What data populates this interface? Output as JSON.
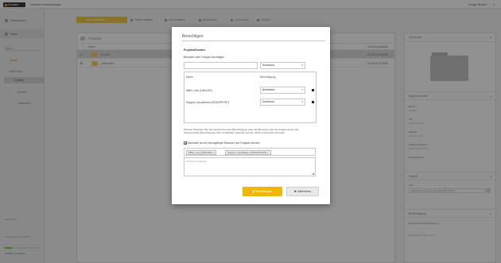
{
  "app": {
    "brand": "Goodset",
    "subtitle": "Document Dateimanager",
    "user": "Doogie Beaver"
  },
  "sidebar": {
    "items": [
      {
        "label": "Dashboard",
        "icon": "dashboard-icon"
      },
      {
        "label": "Drive",
        "icon": "drive-icon"
      }
    ],
    "search_placeholder": "Suche",
    "highlight_label": "Ablage",
    "tree_root": "Mein Drive",
    "tree_active": "Projekte",
    "tree_children": [
      "Kunden",
      "Lieferanten"
    ],
    "footer_label": "Papierkorb",
    "quota_text": "Freigegebener Speicher",
    "quota_fraction": 0.2,
    "footer_link": "Speicher verwalten"
  },
  "toolbar": {
    "upload_label": "Datei hochladen",
    "buttons": [
      "Ordner anlegen",
      "Herunterladen",
      "Berechtigen",
      "Link senden",
      "Löschen"
    ]
  },
  "files_panel": {
    "title": "Projekte",
    "columns": {
      "name": "Name",
      "modified": "Änderungsdatum"
    },
    "rows": [
      {
        "name": "Kunden",
        "date": "04.06.2015 09:08"
      },
      {
        "name": "Lieferanten",
        "date": "04.06.2015 09:08"
      }
    ]
  },
  "details_panel": {
    "title": "Vorschau",
    "section_title": "Eigenschaften",
    "props": [
      {
        "label": "Name",
        "value": "Kunden"
      },
      {
        "label": "Typ",
        "value": "Projektordner"
      },
      {
        "label": "Erstellt",
        "value": "Mueller, Lars"
      },
      {
        "label": "Änderungsdatum",
        "value": "04.06.2015 09:08"
      },
      {
        "label": "Beschreibung",
        "value": ""
      }
    ],
    "link_section": "Zugriff",
    "link_label": "Link",
    "link_value": "https://demo.docbox.de/index.php?id=5f3",
    "sharing_section": "Berechtigung",
    "sharing_text": "Gemeinsame Berechtigung",
    "sharing_sub": "Berechtigt: Mueller, Lars"
  },
  "dialog": {
    "title": "Berechtigen",
    "section": "Projekte/Kunden",
    "add_label": "Benutzer oder Gruppe hinzufügen",
    "add_input_value": "",
    "add_select": "Download",
    "col_name": "Name",
    "col_permission": "Berechtigung",
    "entries": [
      {
        "name": "Miller, Lars (LMILLER)",
        "permission": "Bearbeiten"
      },
      {
        "name": "Support, docu4beam (DSSUPPORT)",
        "permission": "Download"
      }
    ],
    "hint": "Hinweis: Beachten Sie beim Entfernen einer Berechtigung, dass der Benutzer oder die Gruppe durch eine übergeordnete Berechtigung unter Umständen weiterhin auf den Ordner berechtigt sein kann.",
    "notify_label": "Nachricht an neu hinzugefügte Benutzer und Gruppen senden",
    "notify_checked": true,
    "recipients": [
      "Miller, Lars (LMILLER)",
      "Support, docu4beam (DSSUPPORT)"
    ],
    "message_placeholder": "Nachricht eingeben",
    "save_label": "Einstellungen",
    "cancel_label": "Abbrechen"
  },
  "colors": {
    "accent": "#f2b705",
    "overlay": "#000000"
  }
}
